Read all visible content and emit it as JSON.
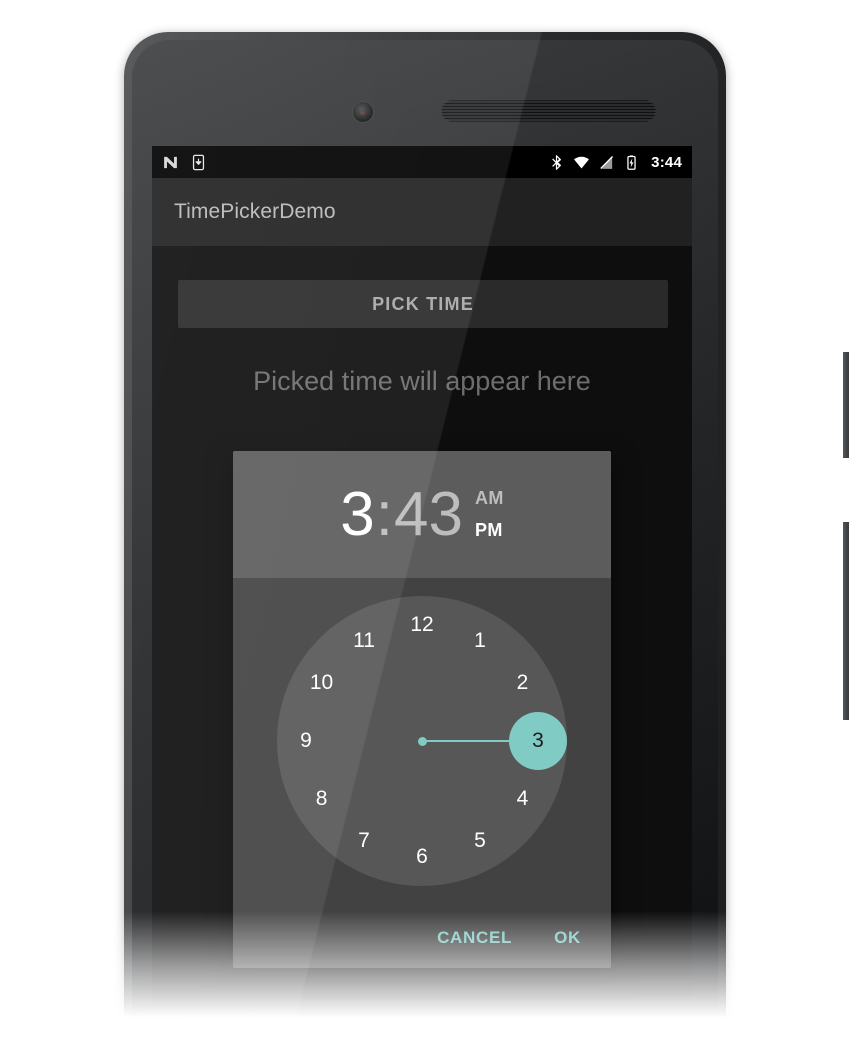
{
  "device": {
    "name": "android-phone",
    "camera_icon": "front-camera-icon",
    "earpiece_icon": "earpiece-speaker-icon",
    "power_button_label": "Power",
    "volume_button_label": "Volume"
  },
  "status_bar": {
    "clock": "3:44",
    "left_icons": [
      {
        "name": "android-n-logo-icon",
        "label": "N"
      },
      {
        "name": "download-icon",
        "label": "Download"
      }
    ],
    "right_icons": [
      {
        "name": "bluetooth-icon",
        "label": "Bluetooth"
      },
      {
        "name": "wifi-icon",
        "label": "Wi-Fi"
      },
      {
        "name": "signal-off-icon",
        "label": "No signal"
      },
      {
        "name": "battery-charging-icon",
        "label": "Battery charging"
      }
    ]
  },
  "app_bar": {
    "title": "TimePickerDemo"
  },
  "app_content": {
    "pick_time_label": "PICK TIME",
    "result_text": "Picked time will appear here"
  },
  "dialog": {
    "hour": "3",
    "separator": ":",
    "minute": "43",
    "am_label": "AM",
    "pm_label": "PM",
    "selected_meridiem": "PM",
    "selected_field": "hour",
    "cancel_label": "CANCEL",
    "ok_label": "OK",
    "selected_hour": "3",
    "clock_numbers": [
      {
        "label": "12",
        "angle": -90
      },
      {
        "label": "1",
        "angle": -60
      },
      {
        "label": "2",
        "angle": -30
      },
      {
        "label": "3",
        "angle": 0
      },
      {
        "label": "4",
        "angle": 30
      },
      {
        "label": "5",
        "angle": 60
      },
      {
        "label": "6",
        "angle": 90
      },
      {
        "label": "7",
        "angle": 120
      },
      {
        "label": "8",
        "angle": 150
      },
      {
        "label": "9",
        "angle": 180
      },
      {
        "label": "10",
        "angle": 210
      },
      {
        "label": "11",
        "angle": 240
      }
    ]
  },
  "colors": {
    "accent": "#80cbc4",
    "dialog_body": "#424242",
    "dialog_header": "#5c5c5c",
    "clock_face": "#575757",
    "app_bar": "#212121",
    "screen_background": "#0e0e0e"
  }
}
